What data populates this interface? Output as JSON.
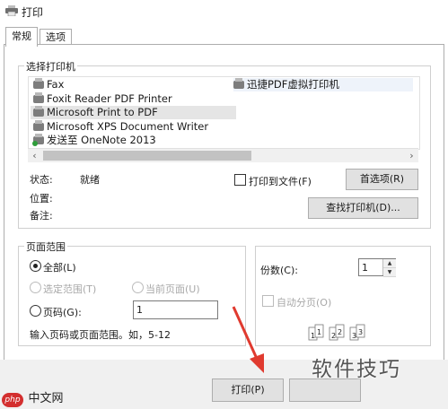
{
  "window": {
    "title": "打印"
  },
  "tabs": [
    {
      "label": "常规"
    },
    {
      "label": "选项"
    }
  ],
  "select_printer": {
    "group_label": "选择打印机",
    "printers": [
      {
        "name": "Fax"
      },
      {
        "name": "Foxit Reader PDF Printer"
      },
      {
        "name": "Microsoft Print to PDF",
        "selected": true
      },
      {
        "name": "Microsoft XPS Document Writer"
      },
      {
        "name": "发送至 OneNote 2013"
      },
      {
        "name": "迅捷PDF虚拟打印机"
      }
    ],
    "scroll_left": "‹",
    "scroll_right": "›"
  },
  "status": {
    "state_label": "状态:",
    "state_value": "就绪",
    "location_label": "位置:",
    "comment_label": "备注:",
    "print_to_file_label": "打印到文件(F)",
    "preferences_button": "首选项(R)",
    "find_printer_button": "查找打印机(D)..."
  },
  "page_range": {
    "group_label": "页面范围",
    "all_label": "全部(L)",
    "selection_label": "选定范围(T)",
    "current_page_label": "当前页面(U)",
    "pages_label": "页码(G):",
    "pages_value": "1",
    "hint": "输入页码或页面范围。如，5-12"
  },
  "copies": {
    "label": "份数(C):",
    "value": "1",
    "collate_label": "自动分页(O)",
    "collate_pages": [
      "1",
      "1",
      "2",
      "2",
      "3",
      "3"
    ]
  },
  "footer": {
    "print_button": "打印(P)"
  },
  "watermark": {
    "right": "软件技巧",
    "left_logo": "php",
    "left_text": "中文网"
  },
  "colors": {
    "selection": "#e5e5e5",
    "arrow": "#e03a2f",
    "button_face": "#e1e1e1"
  }
}
